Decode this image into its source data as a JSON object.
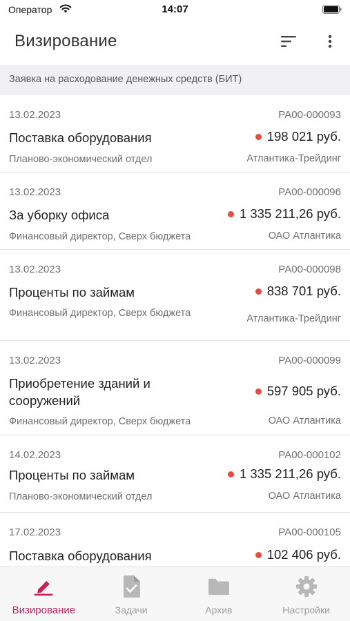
{
  "status_bar": {
    "carrier": "Оператор",
    "time": "14:07"
  },
  "header": {
    "title": "Визирование"
  },
  "section": {
    "title": "Заявка на расходование денежных средств (БИТ)"
  },
  "colors": {
    "accent": "#c8225e",
    "status_dot": "#e84c3d",
    "inactive_icon": "#b8b8b8"
  },
  "documents": [
    {
      "date": "13.02.2023",
      "number": "РА00-000093",
      "title": "Поставка оборудования",
      "amount": "198 021 руб.",
      "department": "Планово-экономический отдел",
      "organization": "Атлантика-Трейдинг"
    },
    {
      "date": "13.02.2023",
      "number": "РА00-000096",
      "title": "За уборку офиса",
      "amount": "1 335 211,26 руб.",
      "department": "Финансовый директор, Сверх бюджета",
      "organization": "ОАО Атлантика"
    },
    {
      "date": "13.02.2023",
      "number": "РА00-000098",
      "title": "Проценты по займам",
      "amount": "838 701 руб.",
      "department": "Финансовый директор, Сверх бюджета",
      "organization": "Атлантика-Трейдинг"
    },
    {
      "date": "13.02.2023",
      "number": "РА00-000099",
      "title": "Приобретение зданий и сооружений",
      "amount": "597 905 руб.",
      "department": "Финансовый директор, Сверх бюджета",
      "organization": "ОАО Атлантика"
    },
    {
      "date": "14.02.2023",
      "number": "РА00-000102",
      "title": "Проценты по займам",
      "amount": "1 335 211,26 руб.",
      "department": "Планово-экономический отдел",
      "organization": "ОАО Атлантика"
    },
    {
      "date": "17.02.2023",
      "number": "РА00-000105",
      "title": "Поставка оборудования",
      "amount": "102 406 руб.",
      "department": "",
      "organization": ""
    }
  ],
  "tabs": [
    {
      "label": "Визирование",
      "icon": "pen-icon",
      "active": true
    },
    {
      "label": "Задачи",
      "icon": "task-document-icon",
      "active": false
    },
    {
      "label": "Архив",
      "icon": "folder-icon",
      "active": false
    },
    {
      "label": "Настройки",
      "icon": "gear-icon",
      "active": false
    }
  ]
}
